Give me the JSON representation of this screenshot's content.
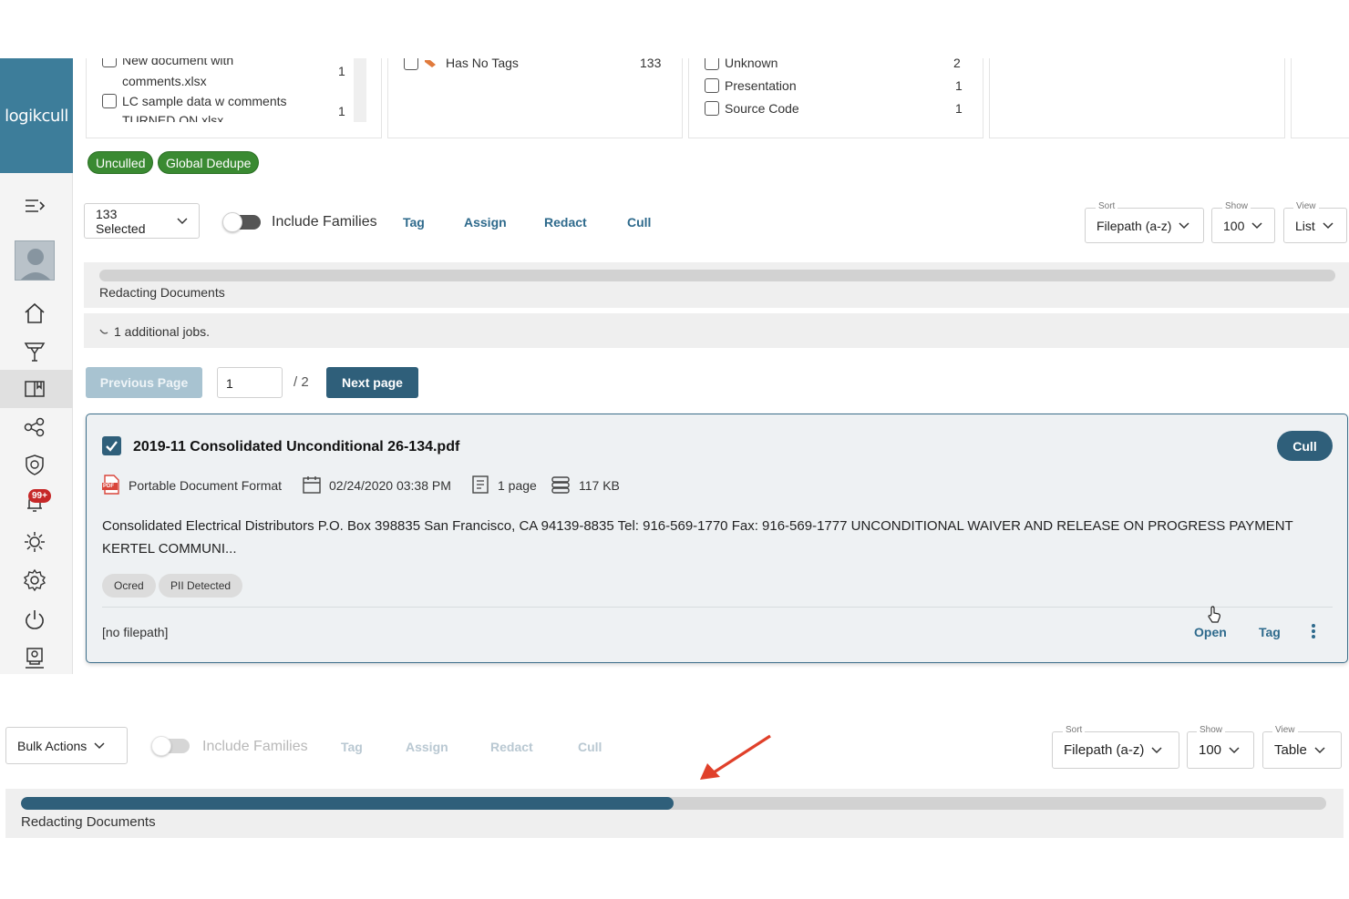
{
  "brand": {
    "logo_text": "logikcull",
    "accent": "#3d7d9a",
    "green": "#3a8a32",
    "link": "#2e6a8c",
    "dark_button": "#2f5f7a"
  },
  "filters": {
    "panel1": {
      "items": [
        {
          "label": "New document with",
          "count": "1"
        },
        {
          "label": "comments.xlsx"
        },
        {
          "label": "LC sample data w comments",
          "count": "1"
        },
        {
          "label": "TURNED ON.xlsx"
        }
      ]
    },
    "panel2": {
      "items": [
        {
          "label": "Has No Tags",
          "count": "133"
        }
      ]
    },
    "panel3": {
      "items": [
        {
          "label": "Unknown",
          "count": "2"
        },
        {
          "label": "Presentation",
          "count": "1"
        },
        {
          "label": "Source Code",
          "count": "1"
        }
      ]
    },
    "pills": [
      "Unculled",
      "Global Dedupe"
    ]
  },
  "toolbar": {
    "selected_label": "133 Selected",
    "include_families": "Include Families",
    "actions": [
      "Tag",
      "Assign",
      "Redact",
      "Cull"
    ],
    "sort": {
      "legend": "Sort",
      "value": "Filepath (a-z)"
    },
    "show": {
      "legend": "Show",
      "value": "100"
    },
    "view": {
      "legend": "View",
      "value": "List"
    }
  },
  "jobs": {
    "title": "Redacting Documents",
    "progress": 0.0,
    "additional": "1 additional jobs."
  },
  "pagination": {
    "prev": "Previous Page",
    "current": "1",
    "total": "/ 2",
    "next": "Next page"
  },
  "document": {
    "filename": "2019-11 Consolidated Unconditional 26-134.pdf",
    "format": "Portable Document Format",
    "pdf_icon_label": "PDF",
    "date": "02/24/2020 03:38 PM",
    "pages": "1 page",
    "size": "117 KB",
    "snippet_line1": "Consolidated Electrical Distributors P.O. Box 398835 San Francisco, CA 94139-8835 Tel: 916-569-1770 Fax: 916-569-1777 UNCONDITIONAL WAIVER AND RELEASE ON PROGRESS PAYMENT",
    "snippet_line2": "KERTEL COMMUNI...",
    "tags": [
      "Ocred",
      "PII Detected"
    ],
    "filepath": "[no filepath]",
    "cull_button": "Cull",
    "open_link": "Open",
    "tag_link": "Tag"
  },
  "sidebar": {
    "notification_count": "99+"
  },
  "lower": {
    "bulk_actions": "Bulk Actions",
    "include_families": "Include Families",
    "actions": [
      "Tag",
      "Assign",
      "Redact",
      "Cull"
    ],
    "sort": {
      "legend": "Sort",
      "value": "Filepath (a-z)"
    },
    "show": {
      "legend": "Show",
      "value": "100"
    },
    "view": {
      "legend": "View",
      "value": "Table"
    },
    "jobs_title": "Redacting Documents",
    "progress": 0.5
  }
}
